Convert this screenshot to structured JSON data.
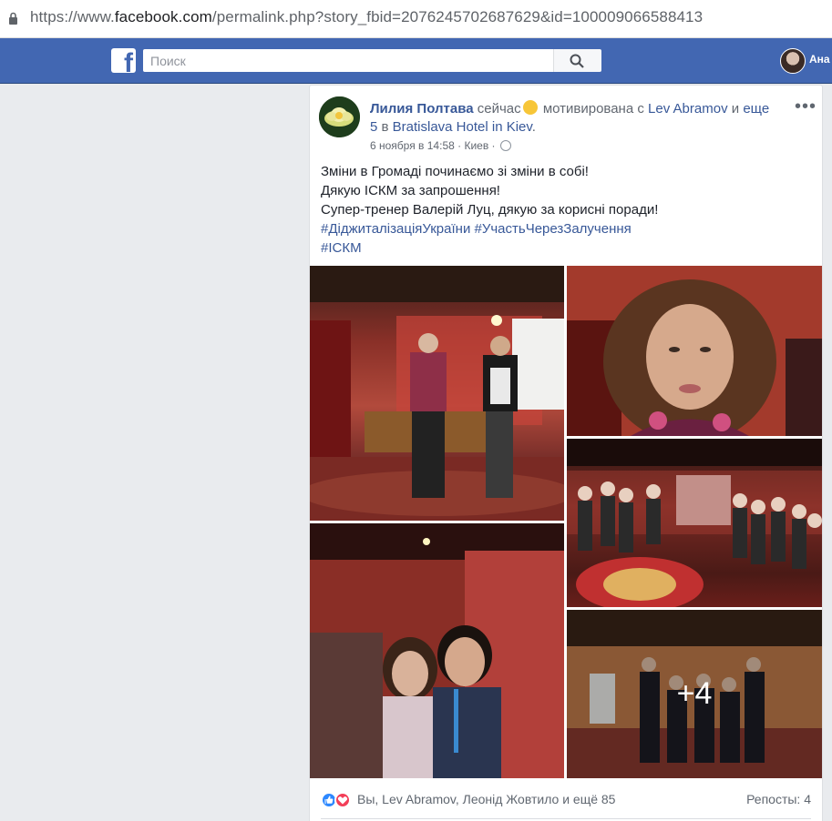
{
  "browser": {
    "url_prefix": "https://www.",
    "url_domain": "facebook.com",
    "url_rest": "/permalink.php?story_fbid=2076245702687629&id=100009066588413"
  },
  "topbar": {
    "logo": "f",
    "search_placeholder": "Поиск",
    "profile_name": "Ана"
  },
  "post": {
    "author": "Лилия Полтава",
    "status_word": "сейчас",
    "feeling_text": "мотивирована с",
    "tagged_person": "Lev Abramov",
    "and_text": "и",
    "others_link": "еще 5",
    "in_text": "в",
    "place": "Bratislava Hotel in Kiev",
    "period": ".",
    "date": "6 ноября в 14:58",
    "location": "Киев",
    "more_icon": "•••",
    "lines": [
      "Зміни в Громаді починаємо зі зміни в собі!",
      "Дякую ІСКМ за запрошення!",
      "Супер-тренер Валерій Луц, дякую за корисні поради!"
    ],
    "hashtags_line1": "#ДіджиталізаціяУкраїни #УчастьЧерезЗалучення",
    "hashtags_line2": "#ІСКМ",
    "more_photos": "+4"
  },
  "reactions": {
    "names": "Вы, Lev Abramov, Леонід Жовтило и ещё 85",
    "shares": "Репосты: 4"
  },
  "icons": {
    "lock": "lock-icon",
    "search": "search-icon",
    "globe": "globe-icon",
    "like": "like-reaction-icon",
    "love": "love-reaction-icon"
  },
  "colors": {
    "fb_blue": "#4267b2",
    "link": "#385898",
    "like": "#2d88ff",
    "love": "#f33e58"
  }
}
